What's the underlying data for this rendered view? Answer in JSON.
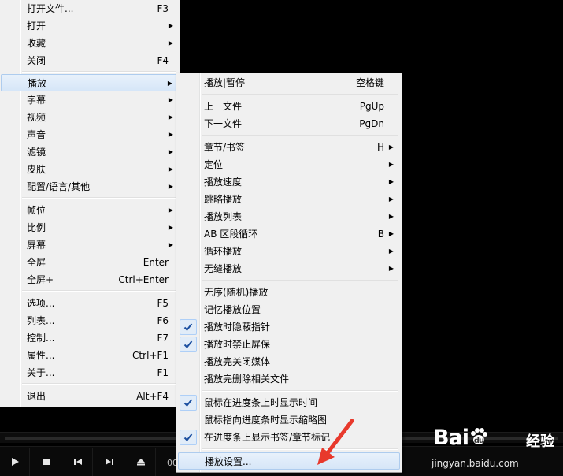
{
  "player": {
    "time_text": "00"
  },
  "main_menu": {
    "items": [
      {
        "label": "打开文件...",
        "shortcut": "F3",
        "submenu": false
      },
      {
        "label": "打开",
        "shortcut": "",
        "submenu": true
      },
      {
        "label": "收藏",
        "shortcut": "",
        "submenu": true
      },
      {
        "label": "关闭",
        "shortcut": "F4",
        "submenu": false
      },
      {
        "label": "播放",
        "shortcut": "",
        "submenu": true
      },
      {
        "label": "字幕",
        "shortcut": "",
        "submenu": true
      },
      {
        "label": "视频",
        "shortcut": "",
        "submenu": true
      },
      {
        "label": "声音",
        "shortcut": "",
        "submenu": true
      },
      {
        "label": "滤镜",
        "shortcut": "",
        "submenu": true
      },
      {
        "label": "皮肤",
        "shortcut": "",
        "submenu": true
      },
      {
        "label": "配置/语言/其他",
        "shortcut": "",
        "submenu": true
      },
      {
        "label": "帧位",
        "shortcut": "",
        "submenu": true
      },
      {
        "label": "比例",
        "shortcut": "",
        "submenu": true
      },
      {
        "label": "屏幕",
        "shortcut": "",
        "submenu": true
      },
      {
        "label": "全屏",
        "shortcut": "Enter",
        "submenu": false
      },
      {
        "label": "全屏+",
        "shortcut": "Ctrl+Enter",
        "submenu": false
      },
      {
        "label": "选项...",
        "shortcut": "F5",
        "submenu": false
      },
      {
        "label": "列表...",
        "shortcut": "F6",
        "submenu": false
      },
      {
        "label": "控制...",
        "shortcut": "F7",
        "submenu": false
      },
      {
        "label": "属性...",
        "shortcut": "Ctrl+F1",
        "submenu": false
      },
      {
        "label": "关于...",
        "shortcut": "F1",
        "submenu": false
      },
      {
        "label": "退出",
        "shortcut": "Alt+F4",
        "submenu": false
      }
    ]
  },
  "sub_menu": {
    "items": [
      {
        "label": "播放|暂停",
        "shortcut": "空格键",
        "submenu": false,
        "checked": false
      },
      {
        "label": "上一文件",
        "shortcut": "PgUp",
        "submenu": false,
        "checked": false
      },
      {
        "label": "下一文件",
        "shortcut": "PgDn",
        "submenu": false,
        "checked": false
      },
      {
        "label": "章节/书签",
        "shortcut": "H",
        "submenu": true,
        "checked": false
      },
      {
        "label": "定位",
        "shortcut": "",
        "submenu": true,
        "checked": false
      },
      {
        "label": "播放速度",
        "shortcut": "",
        "submenu": true,
        "checked": false
      },
      {
        "label": "跳略播放",
        "shortcut": "",
        "submenu": true,
        "checked": false
      },
      {
        "label": "播放列表",
        "shortcut": "",
        "submenu": true,
        "checked": false
      },
      {
        "label": "AB 区段循环",
        "shortcut": "B",
        "submenu": true,
        "checked": false
      },
      {
        "label": "循环播放",
        "shortcut": "",
        "submenu": true,
        "checked": false
      },
      {
        "label": "无缝播放",
        "shortcut": "",
        "submenu": true,
        "checked": false
      },
      {
        "label": "无序(随机)播放",
        "shortcut": "",
        "submenu": false,
        "checked": false
      },
      {
        "label": "记忆播放位置",
        "shortcut": "",
        "submenu": false,
        "checked": false
      },
      {
        "label": "播放时隐蔽指针",
        "shortcut": "",
        "submenu": false,
        "checked": true
      },
      {
        "label": "播放时禁止屏保",
        "shortcut": "",
        "submenu": false,
        "checked": true
      },
      {
        "label": "播放完关闭媒体",
        "shortcut": "",
        "submenu": false,
        "checked": false
      },
      {
        "label": "播放完删除相关文件",
        "shortcut": "",
        "submenu": false,
        "checked": false
      },
      {
        "label": "鼠标在进度条上时显示时间",
        "shortcut": "",
        "submenu": false,
        "checked": true
      },
      {
        "label": "鼠标指向进度条时显示缩略图",
        "shortcut": "",
        "submenu": false,
        "checked": false
      },
      {
        "label": "在进度条上显示书签/章节标记",
        "shortcut": "",
        "submenu": false,
        "checked": true
      },
      {
        "label": "播放设置...",
        "shortcut": "",
        "submenu": false,
        "checked": false
      }
    ]
  },
  "watermark": {
    "logo_left": "Bai",
    "logo_right": "经验",
    "url": "jingyan.baidu.com"
  },
  "colors": {
    "highlight_border": "#aeccee",
    "menu_bg": "#f0f0f0",
    "annotation_arrow": "#e8392c"
  },
  "icons": [
    "play-icon",
    "stop-icon",
    "previous-icon",
    "next-icon",
    "eject-icon",
    "check-icon",
    "submenu-arrow-icon"
  ]
}
